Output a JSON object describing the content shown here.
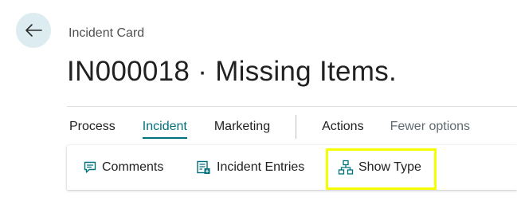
{
  "header": {
    "back_icon": "arrow-left-icon",
    "caption": "Incident Card",
    "title": "IN000018 · Missing Items."
  },
  "tabs": [
    {
      "label": "Process",
      "active": false
    },
    {
      "label": "Incident",
      "active": true
    },
    {
      "label": "Marketing",
      "active": false
    },
    {
      "label": "Actions",
      "active": false
    },
    {
      "label": "Fewer options",
      "active": false
    }
  ],
  "actions": [
    {
      "label": "Comments",
      "icon": "comment-icon"
    },
    {
      "label": "Incident Entries",
      "icon": "entries-icon"
    },
    {
      "label": "Show Type",
      "icon": "hierarchy-icon"
    }
  ],
  "colors": {
    "accent": "#00707c",
    "back_button_bg": "#dcecf0",
    "highlight": "#f5ff00"
  }
}
